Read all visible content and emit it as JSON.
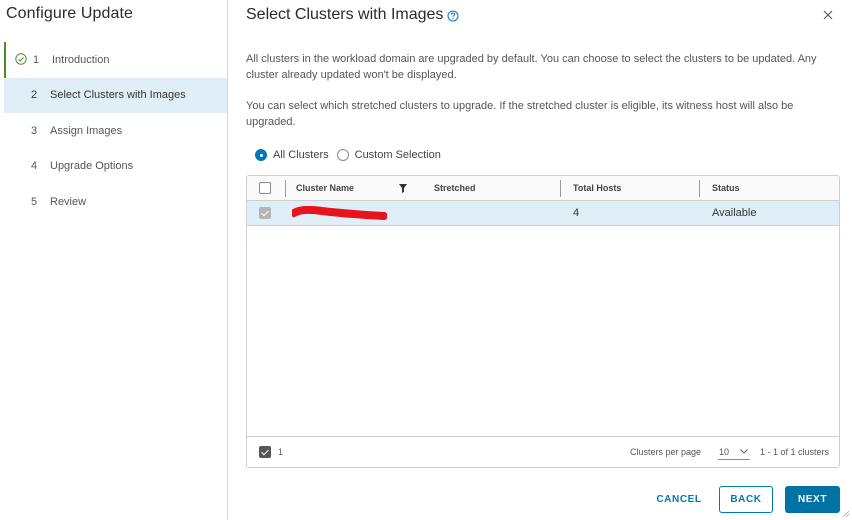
{
  "wizard": {
    "title": "Configure Update",
    "steps": [
      {
        "num": "1",
        "label": "Introduction",
        "state": "done"
      },
      {
        "num": "2",
        "label": "Select Clusters with Images",
        "state": "active"
      },
      {
        "num": "3",
        "label": "Assign Images",
        "state": "pending"
      },
      {
        "num": "4",
        "label": "Upgrade Options",
        "state": "pending"
      },
      {
        "num": "5",
        "label": "Review",
        "state": "pending"
      }
    ]
  },
  "page": {
    "title": "Select Clusters with Images",
    "help_icon": "question-circle-icon",
    "close_icon": "close-icon",
    "para1": "All clusters in the workload domain are upgraded by default. You can choose to select the clusters to be updated. Any cluster already updated won't be displayed.",
    "para2": "You can select which stretched clusters to upgrade. If the stretched cluster is eligible, its witness host will also be upgraded."
  },
  "selection": {
    "options": [
      "All Clusters",
      "Custom Selection"
    ],
    "selected": "All Clusters"
  },
  "grid": {
    "columns": [
      "Cluster Name",
      "Stretched",
      "Total Hosts",
      "Status"
    ],
    "rows": [
      {
        "cluster_name": "",
        "stretched": "",
        "total_hosts": "4",
        "status": "Available",
        "selected": true
      }
    ],
    "footer": {
      "selected_count": "1",
      "per_page_label": "Clusters per page",
      "per_page_value": "10",
      "range": "1 - 1 of 1 clusters"
    }
  },
  "buttons": {
    "cancel": "CANCEL",
    "back": "BACK",
    "next": "NEXT"
  },
  "colors": {
    "accent": "#0079b8",
    "primary_button": "#0072a3",
    "selected_row": "#e0eef8",
    "done_step": "#4e8c2b",
    "redaction": "#e8141d"
  }
}
